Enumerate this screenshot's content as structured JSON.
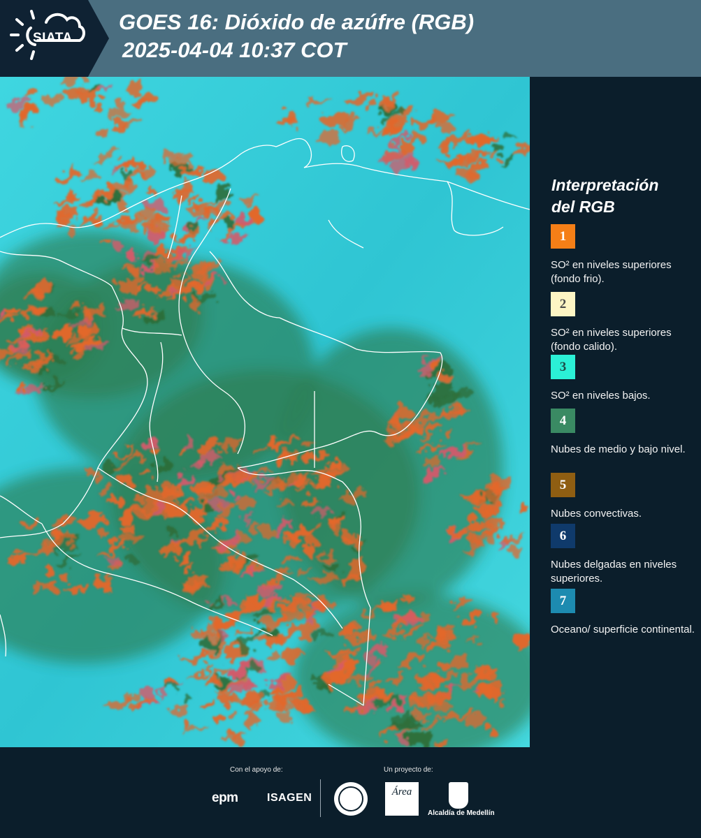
{
  "header": {
    "logo_text": "SIATA",
    "title": "GOES 16: Dióxido de azúfre (RGB)",
    "datetime": "2025-04-04 10:37 COT"
  },
  "legend": {
    "title_line1": "Interpretación",
    "title_line2": "del RGB",
    "items": [
      {
        "number": "1",
        "color": "#f57f17",
        "text": "SO² en niveles superiores (fondo frio)."
      },
      {
        "number": "2",
        "color": "#fdf5c4",
        "text": "SO² en niveles superiores (fondo calido)."
      },
      {
        "number": "3",
        "color": "#2bf0d6",
        "text": "SO² en niveles bajos."
      },
      {
        "number": "4",
        "color": "#3a8a63",
        "text": "Nubes de medio y bajo nivel."
      },
      {
        "number": "5",
        "color": "#8f5e12",
        "text": "Nubes convectivas."
      },
      {
        "number": "6",
        "color": "#0f3a6b",
        "text": "Nubes delgadas en niveles superiores."
      },
      {
        "number": "7",
        "color": "#1d8bb0",
        "text": "Oceano/ superficie continental."
      }
    ]
  },
  "footer": {
    "support_label": "Con el apoyo de:",
    "project_label": "Un proyecto de:",
    "sponsor1": "epm",
    "sponsor2": "ISAGEN",
    "area_logo_text": "Área",
    "alcaldia": "Alcaldía de Medellín"
  },
  "map": {
    "background_color": "#3fd6e0",
    "cloud_colors": [
      "#e2672b",
      "#2d6e3a",
      "#d45a6a"
    ]
  }
}
